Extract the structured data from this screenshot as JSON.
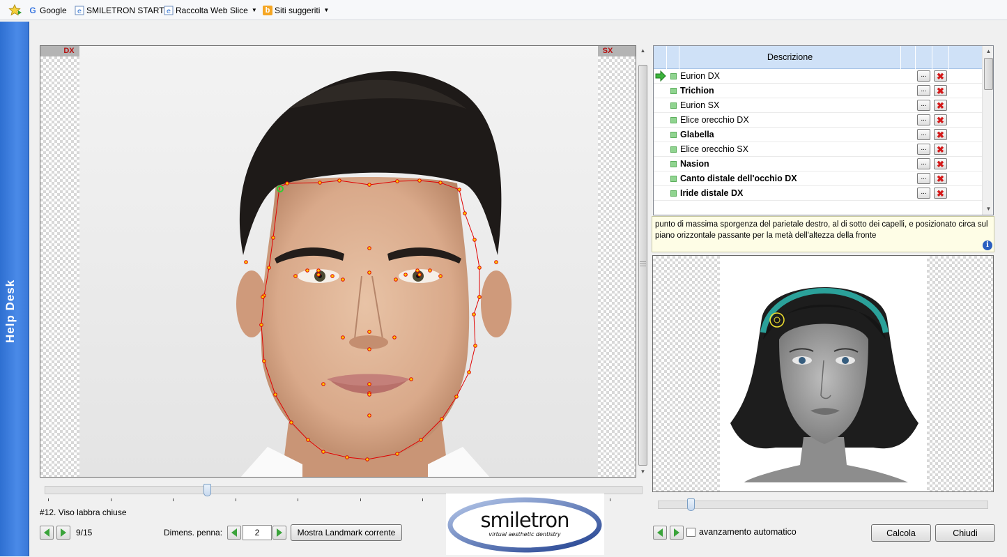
{
  "favorites": {
    "google": "Google",
    "smiletron_start": "SMILETRON START",
    "raccolta": "Raccolta Web Slice",
    "siti": "Siti suggeriti"
  },
  "helpdesk": {
    "label": "Help Desk"
  },
  "viewer": {
    "tag_dx": "DX",
    "tag_sx": "SX"
  },
  "status": {
    "step_title": "#12. Viso labbra chiuse",
    "counter": "9/15",
    "pen_label": "Dimens. penna:",
    "pen_value": "2",
    "show_landmark": "Mostra Landmark corrente"
  },
  "landmarks": {
    "header": "Descrizione",
    "rows": [
      {
        "label": "Eurion DX",
        "bold": false,
        "current": true
      },
      {
        "label": "Trichion",
        "bold": true,
        "current": false
      },
      {
        "label": "Eurion SX",
        "bold": false,
        "current": false
      },
      {
        "label": "Elice orecchio DX",
        "bold": false,
        "current": false
      },
      {
        "label": "Glabella",
        "bold": true,
        "current": false
      },
      {
        "label": "Elice orecchio SX",
        "bold": false,
        "current": false
      },
      {
        "label": "Nasion",
        "bold": true,
        "current": false
      },
      {
        "label": "Canto distale dell'occhio DX",
        "bold": true,
        "current": false
      },
      {
        "label": "Iride distale DX",
        "bold": true,
        "current": false
      }
    ],
    "edit_label": "...",
    "delete_icon": "close-x-icon"
  },
  "description": {
    "text": "punto di massima sporgenza del parietale destro, al di sotto dei capelli, e posizionato circa sul piano orizzontale passante per la metà dell'altezza della fronte",
    "info_glyph": "i"
  },
  "controls": {
    "auto_advance": "avanzamento automatico",
    "calcola": "Calcola",
    "chiudi": "Chiudi"
  },
  "logo": {
    "name": "smiletron",
    "tagline": "virtual aesthetic dentistry"
  },
  "colors": {
    "landmark_line": "#e00000",
    "landmark_point": "#ffcc00",
    "current_point": "#33cc33",
    "header_bg": "#cfe1f7"
  }
}
